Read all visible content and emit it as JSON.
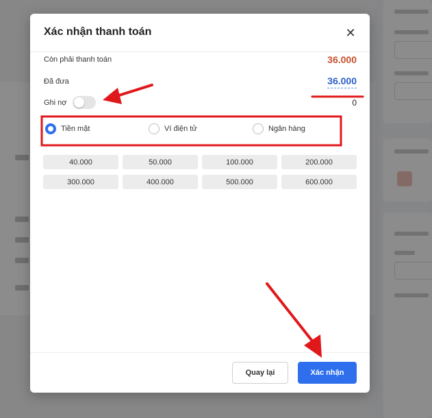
{
  "modal": {
    "title": "Xác nhận thanh toán",
    "close_icon": "close-icon"
  },
  "payment": {
    "due_label": "Còn phải thanh toán",
    "due_value": "36.000",
    "paid_label": "Đã đưa",
    "paid_value": "36.000",
    "debt_label": "Ghi nợ",
    "debt_value": "0",
    "debt_toggle_on": false
  },
  "methods": [
    {
      "label": "Tiền mặt",
      "selected": true
    },
    {
      "label": "Ví điện tử",
      "selected": false
    },
    {
      "label": "Ngân hàng",
      "selected": false
    }
  ],
  "quick_amounts": [
    "40.000",
    "50.000",
    "100.000",
    "200.000",
    "300.000",
    "400.000",
    "500.000",
    "600.000"
  ],
  "footer": {
    "back_label": "Quay lại",
    "confirm_label": "Xác nhận"
  },
  "colors": {
    "accent": "#2f6fed",
    "due_amount": "#c8512a",
    "paid_amount": "#2c5fc9",
    "annotation": "#e0181b"
  }
}
